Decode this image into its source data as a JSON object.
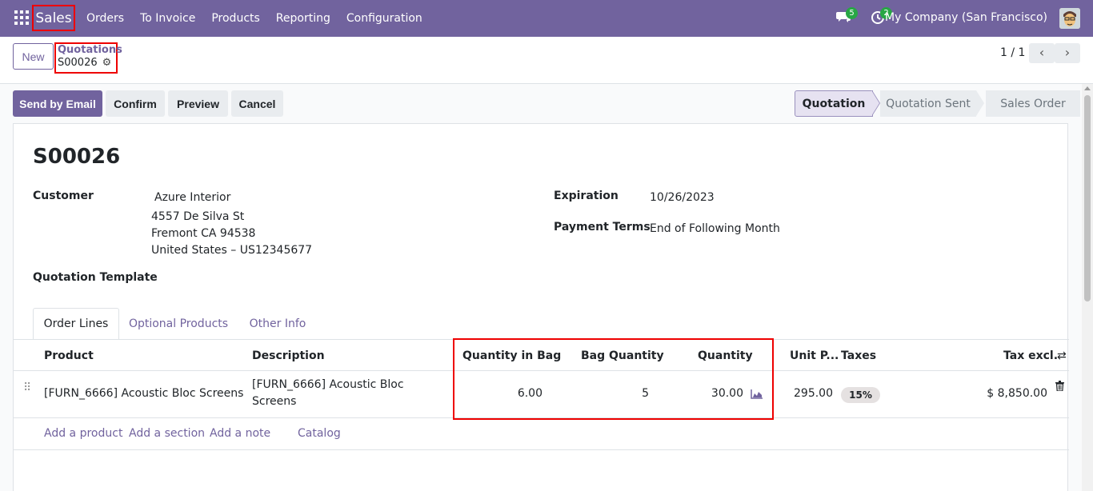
{
  "navbar": {
    "app_name": "Sales",
    "menu": [
      "Orders",
      "To Invoice",
      "Products",
      "Reporting",
      "Configuration"
    ],
    "messages_count": "5",
    "activities_count": "2",
    "company": "My Company (San Francisco)"
  },
  "control": {
    "new_label": "New",
    "breadcrumb_parent": "Quotations",
    "breadcrumb_current": "S00026",
    "pager": "1 / 1"
  },
  "statusbar": {
    "buttons": [
      "Send by Email",
      "Confirm",
      "Preview",
      "Cancel"
    ],
    "stages": [
      "Quotation",
      "Quotation Sent",
      "Sales Order"
    ],
    "active_stage": "Quotation"
  },
  "record": {
    "name": "S00026",
    "customer_label": "Customer",
    "customer_name": "Azure Interior",
    "address_line1": "4557 De Silva St",
    "address_line2": "Fremont CA 94538",
    "address_line3": "United States – US12345677",
    "quotation_template_label": "Quotation Template",
    "expiration_label": "Expiration",
    "expiration_value": "10/26/2023",
    "payment_terms_label": "Payment Terms",
    "payment_terms_value": "End of Following Month"
  },
  "tabs": [
    "Order Lines",
    "Optional Products",
    "Other Info"
  ],
  "table": {
    "headers": {
      "product": "Product",
      "description": "Description",
      "qty_in_bag": "Quantity in Bag",
      "bag_quantity": "Bag Quantity",
      "quantity": "Quantity",
      "unit_price": "Unit P...",
      "taxes": "Taxes",
      "tax_excl": "Tax excl."
    },
    "rows": [
      {
        "product": "[FURN_6666] Acoustic Bloc Screens",
        "description_line1": "[FURN_6666] Acoustic Bloc",
        "description_line2": "Screens",
        "qty_in_bag": "6.00",
        "bag_quantity": "5",
        "quantity": "30.00",
        "unit_price": "295.00",
        "taxes": "15%",
        "tax_excl": "$ 8,850.00"
      }
    ],
    "add_links": [
      "Add a product",
      "Add a section",
      "Add a note",
      "Catalog"
    ]
  },
  "colors": {
    "brand": "#71639e",
    "highlight": "#ee0000",
    "badge": "#28a745"
  }
}
